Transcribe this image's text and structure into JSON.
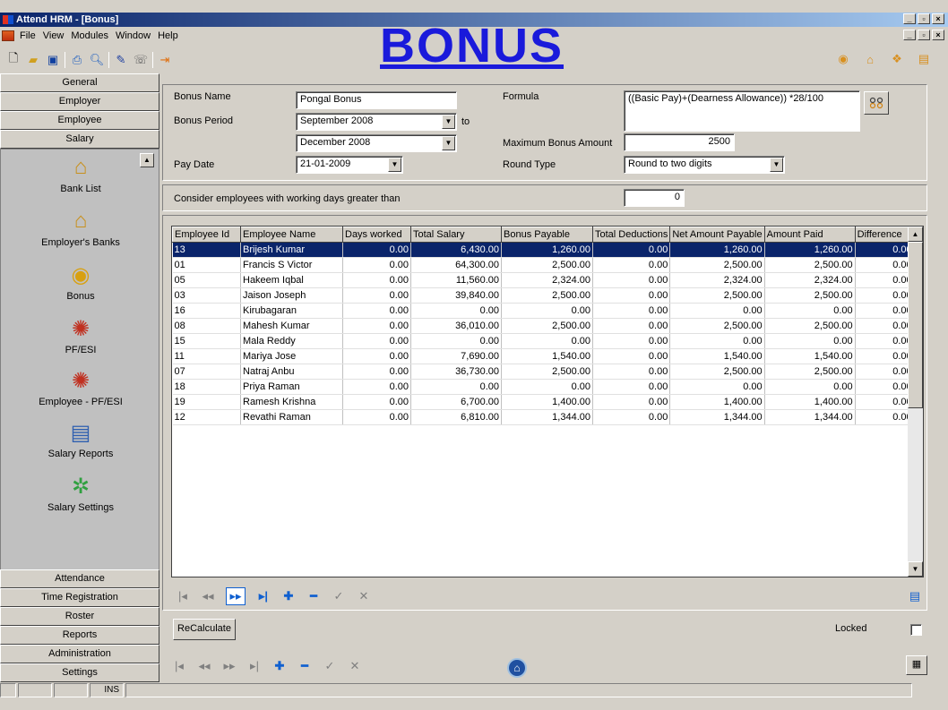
{
  "window": {
    "title": "Attend HRM - [Bonus]"
  },
  "menu": [
    "File",
    "View",
    "Modules",
    "Window",
    "Help"
  ],
  "banner": "BONUS",
  "leftnav": {
    "top_sections": [
      "General",
      "Employer",
      "Employee",
      "Salary"
    ],
    "panel_items": [
      {
        "label": "Bank List",
        "icon": "bank-icon"
      },
      {
        "label": "Employer's Banks",
        "icon": "bank-icon"
      },
      {
        "label": "Bonus",
        "icon": "coins-icon"
      },
      {
        "label": "PF/ESI",
        "icon": "badge-icon"
      },
      {
        "label": "Employee - PF/ESI",
        "icon": "employee-badge-icon"
      },
      {
        "label": "Salary Reports",
        "icon": "report-icon"
      },
      {
        "label": "Salary Settings",
        "icon": "settings-icon"
      }
    ],
    "bottom_sections": [
      "Attendance",
      "Time Registration",
      "Roster",
      "Reports",
      "Administration",
      "Settings"
    ]
  },
  "status": {
    "ins": "INS"
  },
  "form": {
    "bonus_name_label": "Bonus Name",
    "bonus_name": "Pongal Bonus",
    "bonus_period_label": "Bonus Period",
    "period_from": "September 2008",
    "to_label": "to",
    "period_to": "December 2008",
    "pay_date_label": "Pay Date",
    "pay_date": "21-01-2009",
    "formula_label": "Formula",
    "formula": "((Basic Pay)+(Dearness Allowance)) *28/100",
    "max_bonus_label": "Maximum Bonus Amount",
    "max_bonus": "2500",
    "round_type_label": "Round Type",
    "round_type": "Round to two digits",
    "consider_label": "Consider employees with working days greater than",
    "consider_value": "0"
  },
  "grid": {
    "columns": [
      "Employee Id",
      "Employee Name",
      "Days worked",
      "Total Salary",
      "Bonus Payable",
      "Total Deductions",
      "Net Amount Payable",
      "Amount Paid",
      "Difference"
    ],
    "rows": [
      [
        "13",
        "Brijesh Kumar",
        "0.00",
        "6,430.00",
        "1,260.00",
        "0.00",
        "1,260.00",
        "1,260.00",
        "0.00"
      ],
      [
        "01",
        "Francis S  Victor",
        "0.00",
        "64,300.00",
        "2,500.00",
        "0.00",
        "2,500.00",
        "2,500.00",
        "0.00"
      ],
      [
        "05",
        "Hakeem Iqbal",
        "0.00",
        "11,560.00",
        "2,324.00",
        "0.00",
        "2,324.00",
        "2,324.00",
        "0.00"
      ],
      [
        "03",
        "Jaison Joseph",
        "0.00",
        "39,840.00",
        "2,500.00",
        "0.00",
        "2,500.00",
        "2,500.00",
        "0.00"
      ],
      [
        "16",
        "Kirubagaran",
        "0.00",
        "0.00",
        "0.00",
        "0.00",
        "0.00",
        "0.00",
        "0.00"
      ],
      [
        "08",
        "Mahesh Kumar",
        "0.00",
        "36,010.00",
        "2,500.00",
        "0.00",
        "2,500.00",
        "2,500.00",
        "0.00"
      ],
      [
        "15",
        "Mala Reddy",
        "0.00",
        "0.00",
        "0.00",
        "0.00",
        "0.00",
        "0.00",
        "0.00"
      ],
      [
        "11",
        "Mariya Jose",
        "0.00",
        "7,690.00",
        "1,540.00",
        "0.00",
        "1,540.00",
        "1,540.00",
        "0.00"
      ],
      [
        "07",
        "Natraj Anbu",
        "0.00",
        "36,730.00",
        "2,500.00",
        "0.00",
        "2,500.00",
        "2,500.00",
        "0.00"
      ],
      [
        "18",
        "Priya Raman",
        "0.00",
        "0.00",
        "0.00",
        "0.00",
        "0.00",
        "0.00",
        "0.00"
      ],
      [
        "19",
        "Ramesh Krishna",
        "0.00",
        "6,700.00",
        "1,400.00",
        "0.00",
        "1,400.00",
        "1,400.00",
        "0.00"
      ],
      [
        "12",
        "Revathi Raman",
        "0.00",
        "6,810.00",
        "1,344.00",
        "0.00",
        "1,344.00",
        "1,344.00",
        "0.00"
      ]
    ]
  },
  "recalculate_label": "ReCalculate",
  "locked_label": "Locked",
  "colors": {
    "selection": "#0a246a",
    "banner": "#1a1adb",
    "face": "#d4d0c8"
  }
}
